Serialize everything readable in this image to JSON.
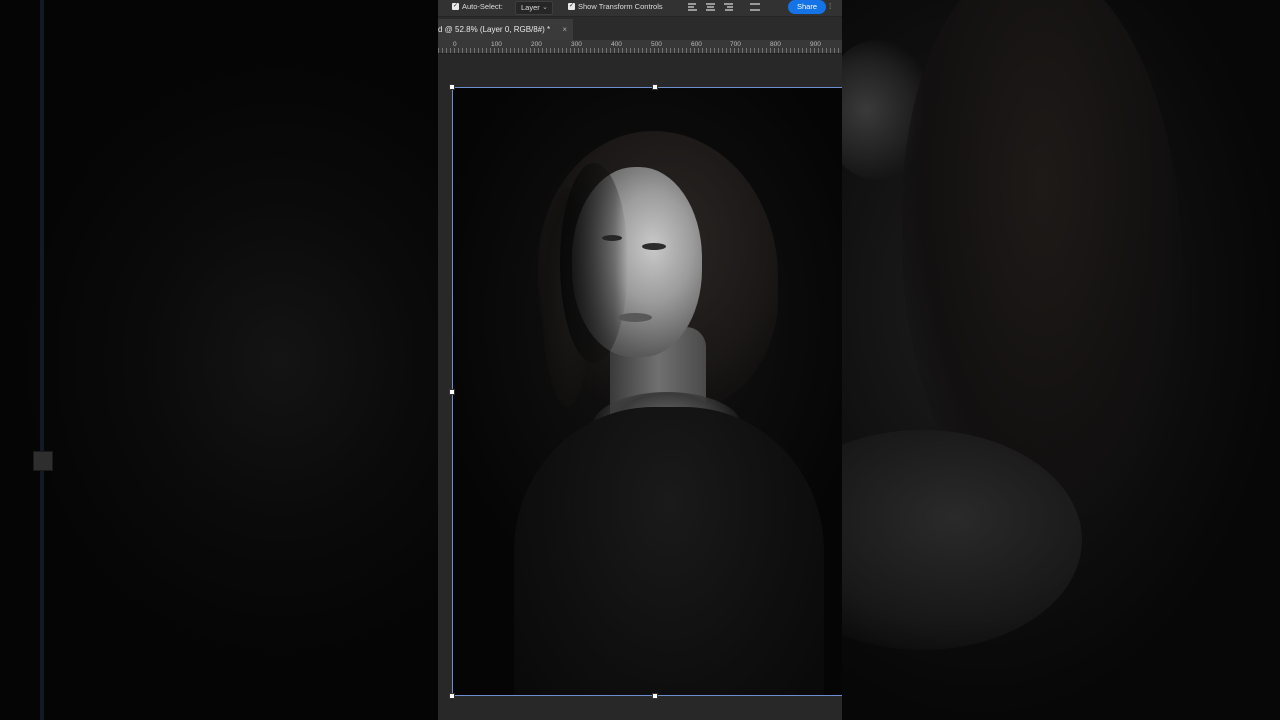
{
  "options_bar": {
    "auto_select_label": "Auto-Select:",
    "auto_select_checked": true,
    "layer_select_value": "Layer",
    "show_transform_label": "Show Transform Controls",
    "show_transform_checked": true,
    "share_label": "Share",
    "share_color": "#1473e6"
  },
  "document_tab": {
    "title": "d @ 52.8% (Layer 0, RGB/8#) *",
    "close_glyph": "×"
  },
  "ruler": {
    "labels": [
      "0",
      "100",
      "200",
      "300",
      "400",
      "500",
      "600",
      "700",
      "800",
      "900"
    ]
  },
  "canvas": {
    "image": "black-and-white portrait of a woman",
    "selection_color": "#6d8fcf"
  }
}
